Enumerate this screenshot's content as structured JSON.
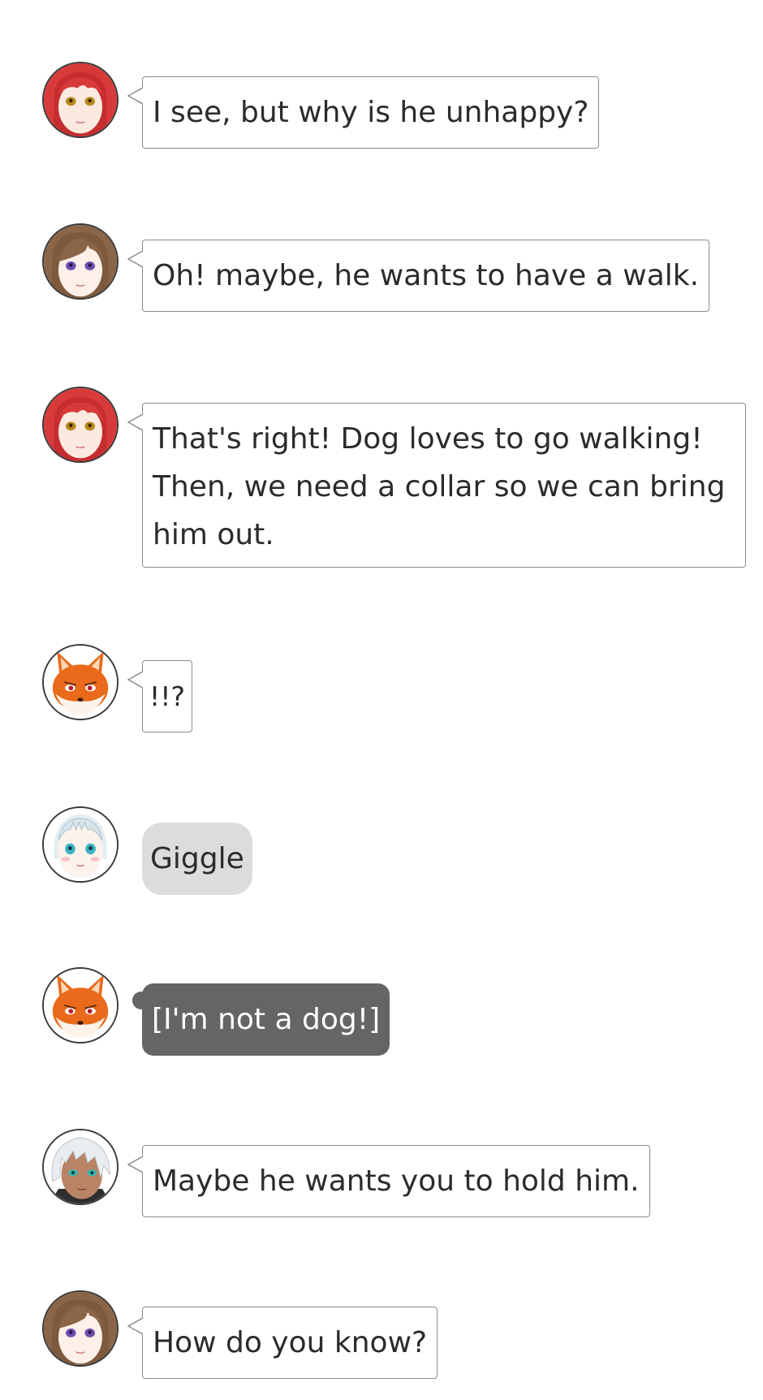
{
  "messages": [
    {
      "speaker": "red-hair-girl",
      "text": "I see, but why is he unhappy?"
    },
    {
      "speaker": "brown-hair-girl",
      "text": "Oh! maybe, he wants to have a walk."
    },
    {
      "speaker": "red-hair-girl",
      "text": "That's right! Dog loves to go walking! Then, we need a collar so we can bring him out."
    },
    {
      "speaker": "fox",
      "text": "!!?"
    },
    {
      "speaker": "silver-hair-girl",
      "text": "Giggle"
    },
    {
      "speaker": "fox",
      "text": "[I'm not a dog!]"
    },
    {
      "speaker": "white-hair-boy",
      "text": "Maybe he wants you to hold him."
    },
    {
      "speaker": "brown-hair-girl",
      "text": "How do you know?"
    }
  ],
  "colors": {
    "bubble_border": "#8c8c8c",
    "thought_bubble": "#dcdcdc",
    "translation_bubble": "#656565",
    "text": "#2b2b2b"
  }
}
